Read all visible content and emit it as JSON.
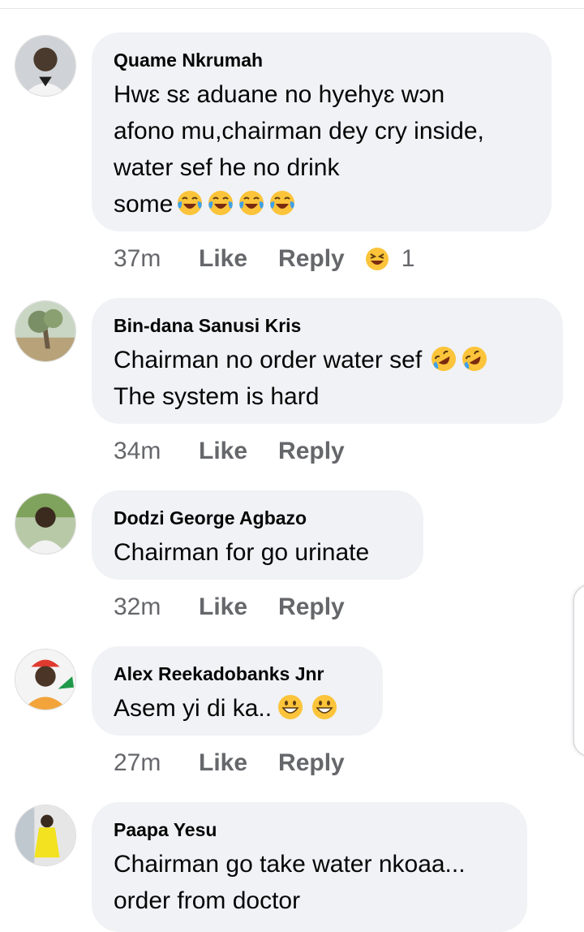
{
  "comments": [
    {
      "author": "Quame Nkrumah",
      "lines": [
        "Hwɛ sɛ aduane no hyehyɛ wɔn",
        "afono mu,chairman dey cry inside,",
        "water sef he no drink",
        "some"
      ],
      "trailing_emojis": [
        "face-with-tears-of-joy-icon",
        "face-with-tears-of-joy-icon",
        "face-with-tears-of-joy-icon",
        "face-with-tears-of-joy-icon"
      ],
      "time": "37m",
      "like_label": "Like",
      "reply_label": "Reply",
      "reaction": {
        "icon": "haha-reaction-icon",
        "count": "1"
      }
    },
    {
      "author": "Bin-dana Sanusi Kris",
      "lines": [
        "Chairman no order water sef",
        "The system is hard"
      ],
      "trailing_emojis": [
        "rolling-on-floor-laughing-icon",
        "rolling-on-floor-laughing-icon"
      ],
      "time": "34m",
      "like_label": "Like",
      "reply_label": "Reply"
    },
    {
      "author": "Dodzi George Agbazo",
      "lines": [
        "Chairman for go urinate"
      ],
      "time": "32m",
      "like_label": "Like",
      "reply_label": "Reply"
    },
    {
      "author": "Alex Reekadobanks Jnr",
      "lines": [
        "Asem yi di ka.."
      ],
      "trailing_emojis": [
        "grinning-face-icon",
        "grinning-face-icon"
      ],
      "time": "27m",
      "like_label": "Like",
      "reply_label": "Reply"
    },
    {
      "author": "Paapa Yesu",
      "lines": [
        "Chairman go take water nkoaa...",
        "order from doctor"
      ]
    }
  ],
  "colors": {
    "bubble": "#f0f2f5",
    "meta_text": "#65676b",
    "emoji_yellow": "#fbc43a",
    "emoji_blue_tear": "#3fa0ea"
  }
}
